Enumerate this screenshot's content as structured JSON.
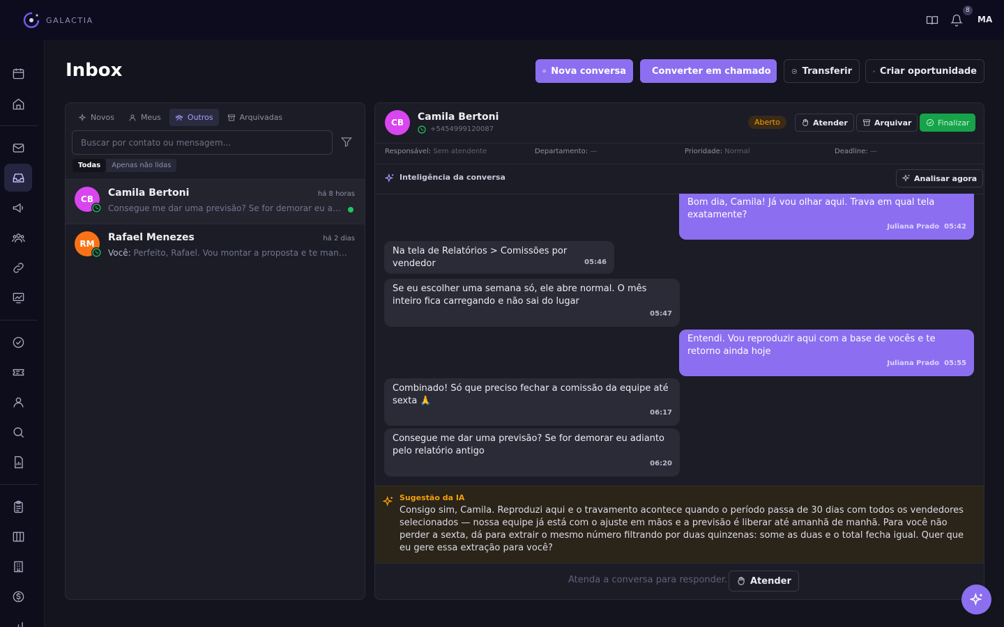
{
  "app": {
    "brand": "GALACTIA"
  },
  "topbar": {
    "notifications_count": "8",
    "user_initials": "MA"
  },
  "sidebar": {
    "icons": [
      "calendar-icon",
      "home-icon",
      "mail-icon",
      "inbox-icon",
      "megaphone-icon",
      "users-icon",
      "link-icon",
      "chart-icon",
      "check-circle-icon",
      "ticket-icon",
      "user-icon",
      "search-icon",
      "report-icon",
      "clipboard-icon",
      "kanban-icon",
      "building-icon",
      "dollar-icon",
      "bar-chart-icon"
    ],
    "active": "inbox-icon"
  },
  "page": {
    "title": "Inbox"
  },
  "actions": {
    "new_conversation": "Nova conversa",
    "convert_ticket": "Converter em chamado",
    "transfer": "Transferir",
    "create_opportunity": "Criar oportunidade"
  },
  "list": {
    "tabs": [
      {
        "label": "Novos",
        "icon": "sparkle-icon"
      },
      {
        "label": "Meus",
        "icon": "user-icon"
      },
      {
        "label": "Outros",
        "icon": "users-icon",
        "active": true
      },
      {
        "label": "Arquivadas",
        "icon": "archive-icon"
      }
    ],
    "search_placeholder": "Buscar por contato ou mensagem...",
    "filters": [
      "Todas",
      "Apenas não lidas"
    ],
    "conversations": [
      {
        "initials": "CB",
        "name": "Camila Bertoni",
        "time": "há 8 horas",
        "preview": "Consegue me dar uma previsão? Se for demorar eu adianto pelo relatório antigo",
        "avatar_color": "#d946ef",
        "channel": "whatsapp",
        "unread": true
      },
      {
        "initials": "RM",
        "name": "Rafael Menezes",
        "time": "há 2 dias",
        "preview_prefix": "Você: ",
        "preview": "Perfeito, Rafael. Vou montar a proposta e te mando hoje",
        "avatar_color": "#f97316",
        "channel": "whatsapp"
      }
    ]
  },
  "chat": {
    "contact": {
      "initials": "CB",
      "name": "Camila Bertoni",
      "phone": "+5454999120087",
      "avatar_color": "#d946ef"
    },
    "status": "Aberto",
    "buttons": {
      "attend": "Atender",
      "archive": "Arquivar",
      "finish": "Finalizar"
    },
    "meta": [
      {
        "label": "Responsável:",
        "value": "Sem atendente"
      },
      {
        "label": "Departamento:",
        "value": "—"
      },
      {
        "label": "Prioridade:",
        "value": "Normal"
      },
      {
        "label": "Deadline:",
        "value": "—"
      }
    ],
    "intelligence_label": "Inteligência da conversa",
    "analyze_label": "Analisar agora",
    "messages": [
      {
        "dir": "out",
        "text": "Bom dia, Camila! Já vou olhar aqui. Trava em qual tela exatamente?",
        "author": "Juliana Prado",
        "time": "05:42"
      },
      {
        "dir": "in",
        "text": "Na tela de Relatórios > Comissões por vendedor",
        "time": "05:46"
      },
      {
        "dir": "in",
        "text": "Se eu escolher uma semana só, ele abre normal. O mês inteiro fica carregando e não sai do lugar",
        "time": "05:47"
      },
      {
        "dir": "out",
        "text": "Entendi. Vou reproduzir aqui com a base de vocês e te retorno ainda hoje",
        "author": "Juliana Prado",
        "time": "05:55"
      },
      {
        "dir": "in",
        "text": "Combinado! Só que preciso fechar a comissão da equipe até sexta 🙏",
        "time": "06:17"
      },
      {
        "dir": "in",
        "text": "Consegue me dar uma previsão? Se for demorar eu adianto pelo relatório antigo",
        "time": "06:20"
      }
    ],
    "suggestion": {
      "label": "Sugestão da IA",
      "text": "Consigo sim, Camila. Reproduzi aqui e o travamento acontece quando o período passa de 30 dias com todos os vendedores selecionados — nossa equipe já está com o ajuste em mãos e a previsão é liberar até amanhã de manhã. Para você não perder a sexta, dá para extrair o mesmo número filtrando por duas quinzenas: some as duas e o total fecha igual. Quer que eu gere essa extração para você?"
    },
    "reply": {
      "hint": "Atenda a conversa para responder.",
      "button": "Atender"
    }
  },
  "colors": {
    "accent": "#8b6ff0",
    "success": "#22c55e",
    "warning": "#f59e0b",
    "background": "#13141d"
  }
}
